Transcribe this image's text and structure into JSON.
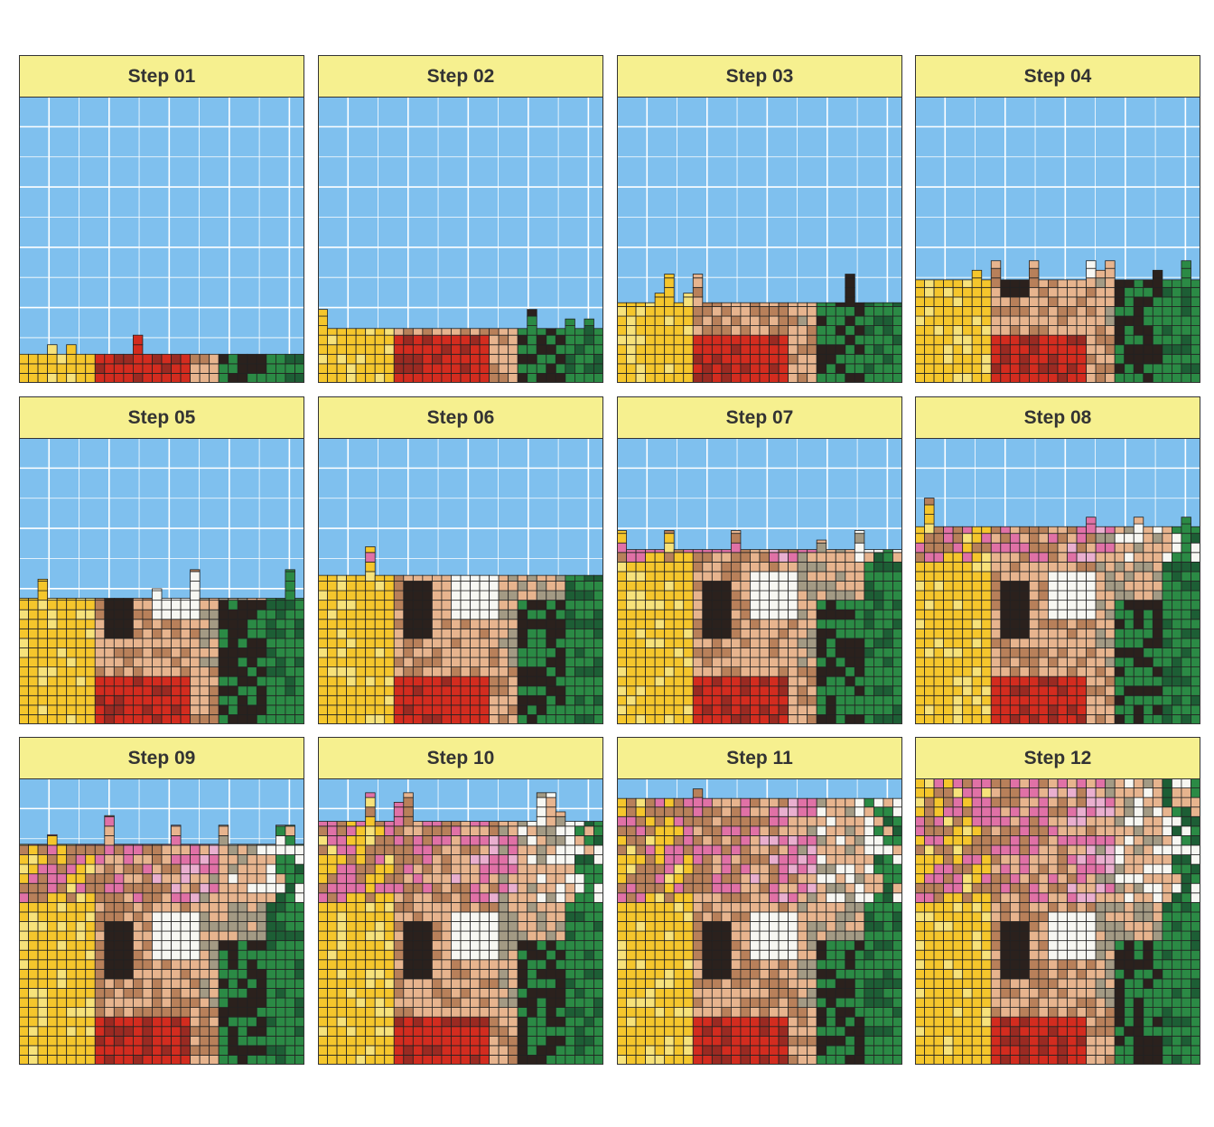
{
  "colors": {
    "sky": "#7FC0EE",
    "grid": "#FFFFFF",
    "strip_fill": "#F6F08F",
    "outline": "#222222",
    "yellow": "#F5C62C",
    "pale_yellow": "#F7E27A",
    "red": "#D32C1F",
    "dark_red": "#9A2A22",
    "skin": "#E7B48E",
    "brown": "#B8805A",
    "dark_brown": "#2B211D",
    "grey": "#A39A84",
    "white": "#F7F7F2",
    "green": "#2B8A45",
    "dark_green": "#1D5E35",
    "pink": "#E071A6",
    "light_pink": "#E9AFCF"
  },
  "chart_data": {
    "type": "heatmap",
    "description_source": "small multiples of a stacked mosaic filling from the bottom",
    "panels": [
      {
        "label": "Step 01",
        "fill_fraction": 0.1
      },
      {
        "label": "Step 02",
        "fill_fraction": 0.19
      },
      {
        "label": "Step 03",
        "fill_fraction": 0.28
      },
      {
        "label": "Step 04",
        "fill_fraction": 0.36
      },
      {
        "label": "Step 05",
        "fill_fraction": 0.44
      },
      {
        "label": "Step 06",
        "fill_fraction": 0.52
      },
      {
        "label": "Step 07",
        "fill_fraction": 0.61
      },
      {
        "label": "Step 08",
        "fill_fraction": 0.69
      },
      {
        "label": "Step 09",
        "fill_fraction": 0.77
      },
      {
        "label": "Step 10",
        "fill_fraction": 0.85
      },
      {
        "label": "Step 11",
        "fill_fraction": 0.93
      },
      {
        "label": "Step 12",
        "fill_fraction": 1.0
      }
    ],
    "grid": "on",
    "legend": "none"
  }
}
